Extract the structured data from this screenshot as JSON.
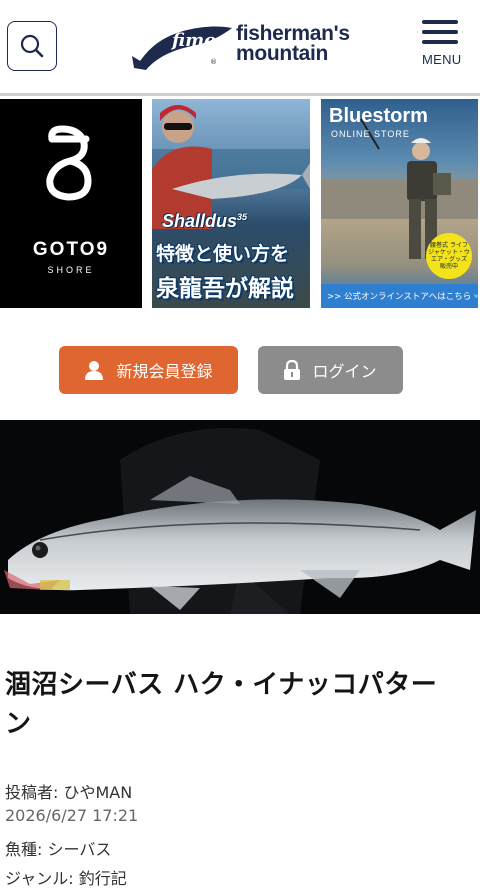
{
  "header": {
    "logo_script": "fimo",
    "logo_mark": "®",
    "logo_line1": "fisherman's",
    "logo_line2": "mountain",
    "menu_label": "MENU",
    "search_icon": "search-icon",
    "menu_icon": "hamburger-icon"
  },
  "banners": [
    {
      "id": "goto9",
      "title": "GOTO9",
      "subtitle": "SHORE"
    },
    {
      "id": "shalldus",
      "product": "Shalldus",
      "sup": "35",
      "line1": "特徴と使い方を",
      "line2": "泉龍吾が解説"
    },
    {
      "id": "bluestorm",
      "title": "Bluestorm",
      "subtitle": "ONLINE STORE",
      "badge": "腰巻式 ライフジャケット・ウエア・グッズ 販売中",
      "footer": ">> 公式オンラインストアへはこちら"
    }
  ],
  "auth": {
    "register_label": "新規会員登録",
    "login_label": "ログイン",
    "register_color": "#e06631",
    "login_color": "#8c8c8c"
  },
  "article": {
    "title": "涸沼シーバス ハク・イナッコパターン",
    "author_label": "投稿者: ",
    "author": "ひやMAN",
    "date": "2026/6/27 17:21",
    "species_label": "魚種: ",
    "species": "シーバス",
    "genre_label": "ジャンル: ",
    "genre": "釣行記"
  },
  "colors": {
    "navy": "#1d2a4d",
    "accent": "#e06631"
  }
}
